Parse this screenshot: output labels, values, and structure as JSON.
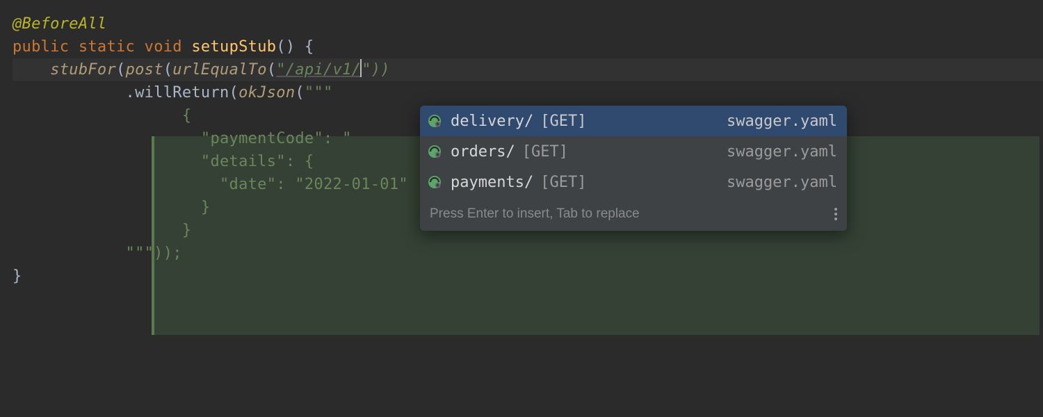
{
  "code": {
    "annotation": "@BeforeAll",
    "kw_public": "public",
    "kw_static": "static",
    "kw_void": "void",
    "method_name": "setupStub",
    "stubFor": "stubFor",
    "post": "post",
    "urlEqualTo": "urlEqualTo",
    "url_string": "\"/api/v1/",
    "url_close_quote_parens": "\"))",
    "willReturn": ".willReturn",
    "okJson": "okJson",
    "triple_open": "\"\"\"",
    "brace_open": "{",
    "paymentCode_key": "\"paymentCode\"",
    "paymentCode_val": "\"",
    "details_key": "\"details\"",
    "date_key": "\"date\"",
    "date_val": "\"2022-01-01\"",
    "brace_close": "}",
    "triple_close_tail": "\"\"\"));",
    "colon": ": ",
    "obrace": " {",
    "cbrace": "}"
  },
  "popup": {
    "items": [
      {
        "name": "delivery/",
        "method": "[GET]",
        "source": "swagger.yaml",
        "selected": true
      },
      {
        "name": "orders/",
        "method": "[GET]",
        "source": "swagger.yaml",
        "selected": false
      },
      {
        "name": "payments/",
        "method": "[GET]",
        "source": "swagger.yaml",
        "selected": false
      }
    ],
    "footer": "Press Enter to insert, Tab to replace"
  }
}
